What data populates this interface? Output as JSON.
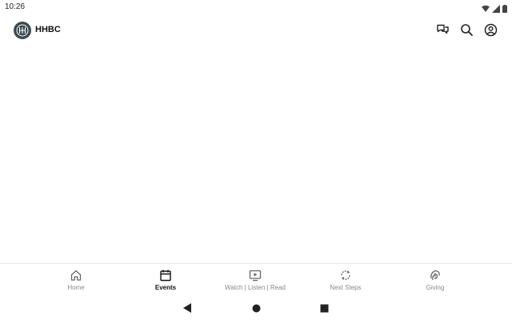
{
  "status_bar": {
    "time": "10:26",
    "icons": [
      "wifi-icon",
      "cell-signal-icon",
      "battery-icon"
    ]
  },
  "app_bar": {
    "logo_icon": "hh-logo-icon",
    "title": "HHBC",
    "actions": [
      {
        "icon": "chat-icon"
      },
      {
        "icon": "search-icon"
      },
      {
        "icon": "account-icon"
      }
    ]
  },
  "bottom_nav": {
    "items": [
      {
        "label": "Home",
        "icon": "home-icon",
        "active": false
      },
      {
        "label": "Events",
        "icon": "calendar-icon",
        "active": true
      },
      {
        "label": "Watch | Listen | Read",
        "icon": "play-screen-icon",
        "active": false
      },
      {
        "label": "Next Steps",
        "icon": "refresh-steps-icon",
        "active": false
      },
      {
        "label": "Giving",
        "icon": "giving-icon",
        "active": false
      }
    ]
  },
  "system_nav": {
    "buttons": [
      "back-icon",
      "home-circle-icon",
      "recents-icon"
    ]
  },
  "colors": {
    "logo_bg": "#3b4a50",
    "active_label": "#111111",
    "inactive_label": "#888888"
  }
}
